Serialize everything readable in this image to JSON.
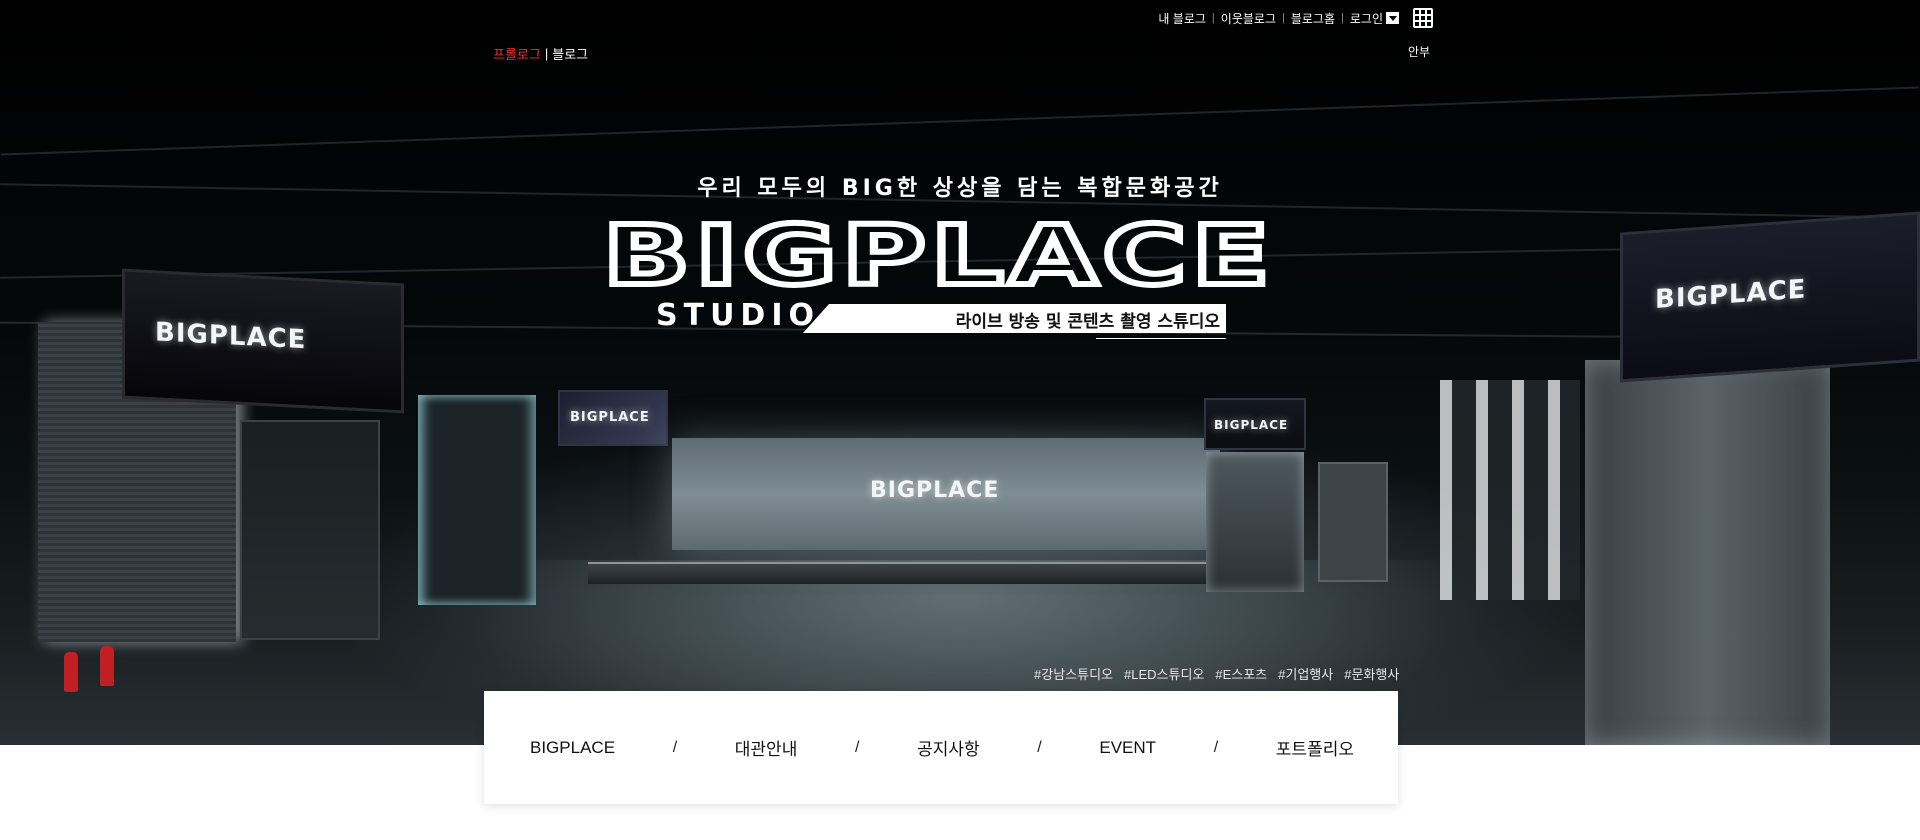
{
  "gnb": {
    "my_blog": "내 블로그",
    "neighbor_blog": "이웃블로그",
    "blog_home": "블로그홈",
    "login": "로그인"
  },
  "lnb": {
    "prologue": "프롤로그",
    "blog": "블로그",
    "notice": "안부"
  },
  "hero": {
    "tagline": "우리 모두의 BIG한 상상을 담는 복합문화공간",
    "brand": "BIGPLACE",
    "studio": "STUDIO",
    "subtitle": "라이브 방송 및 콘텐츠 촬영 스튜디오",
    "screen_logos": [
      "BIGPLACE",
      "BIGPLACE",
      "BIGPLACE",
      "BIGPLACE",
      "BIGPLACE"
    ]
  },
  "hashtags": [
    "#강남스튜디오",
    "#LED스튜디오",
    "#E스포츠",
    "#기업행사",
    "#문화행사"
  ],
  "menu": {
    "items": [
      "BIGPLACE",
      "대관안내",
      "공지사항",
      "EVENT",
      "포트폴리오"
    ],
    "separator": "/"
  },
  "colors": {
    "accent_red": "#ff2a2a",
    "hero_bg": "#000000",
    "card_bg": "#ffffff"
  }
}
